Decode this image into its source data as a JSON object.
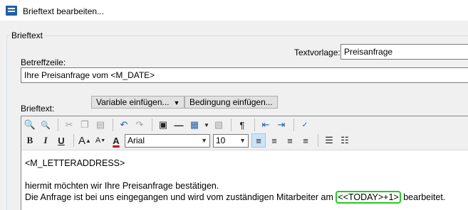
{
  "window": {
    "title": "Brieftext bearbeiten..."
  },
  "group": {
    "label": "Brieftext"
  },
  "template": {
    "label": "Textvorlage:",
    "value": "Preisanfrage"
  },
  "subject": {
    "label": "Betreffzeile:",
    "value": "Ihre Preisanfrage vom <M_DATE>"
  },
  "body": {
    "label": "Brieftext:"
  },
  "buttons": {
    "insert_variable": "Variable einfügen...",
    "insert_condition": "Bedingung einfügen..."
  },
  "toolbar": {
    "font": "Arial",
    "size": "10",
    "icons": [
      "find-icon",
      "find-replace-icon",
      "cut-icon",
      "copy-icon",
      "paste-icon",
      "undo-icon",
      "redo-icon",
      "page-break-icon",
      "horizontal-line-icon",
      "table-icon",
      "image-icon",
      "paragraph-mark-icon",
      "outdent-icon",
      "indent-icon",
      "spellcheck-icon",
      "bold-icon",
      "italic-icon",
      "underline-icon",
      "grow-font-icon",
      "shrink-font-icon",
      "font-color-icon",
      "align-left-icon",
      "align-center-icon",
      "align-right-icon",
      "justify-icon",
      "bullet-list-icon",
      "numbered-list-icon"
    ],
    "colors": {
      "font_color": "#cc0000",
      "highlight": "#22cc22",
      "active_bg": "#cce4f7"
    }
  },
  "content": {
    "line1": "<M_LETTERADDRESS>",
    "line2": "hiermit möchten wir Ihre Preisanfrage bestätigen.",
    "line3_before": "Die Anfrage ist bei uns eingegangen und wird vom zuständigen Mitarbeiter am ",
    "line3_var": "<<TODAY>+1>",
    "line3_after": " bearbeitet."
  }
}
